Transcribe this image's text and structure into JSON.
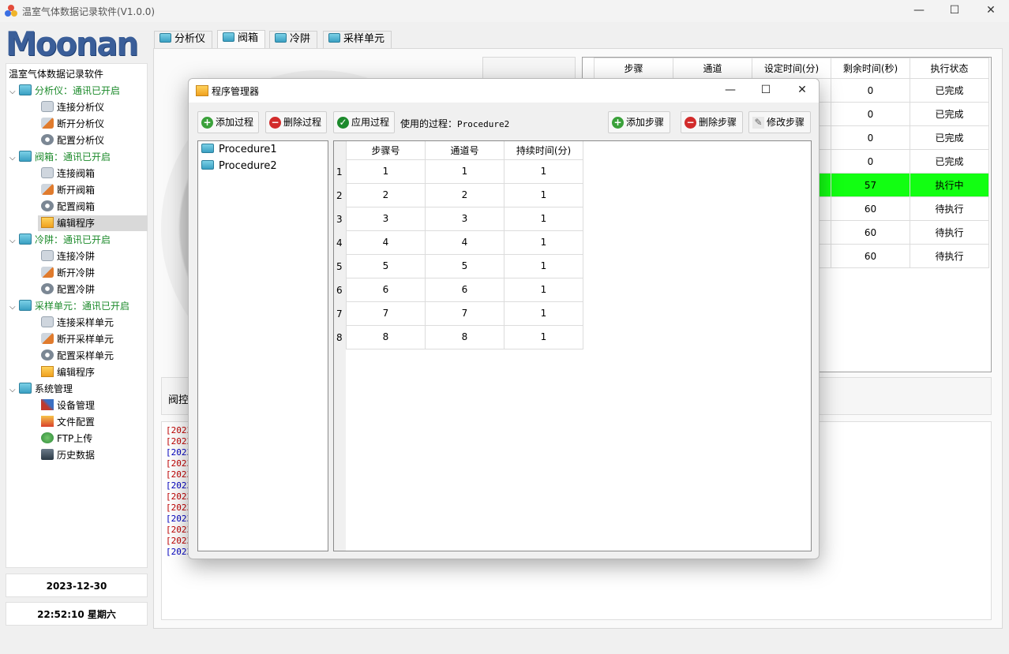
{
  "window": {
    "title": "温室气体数据记录软件(V1.0.0)",
    "minimize": "—",
    "maximize": "☐",
    "close": "✕"
  },
  "logo": "Moonan",
  "tree": {
    "header": "温室气体数据记录软件",
    "groups": [
      {
        "label": "分析仪：通讯已开启",
        "items": [
          "连接分析仪",
          "断开分析仪",
          "配置分析仪"
        ]
      },
      {
        "label": "阀箱：通讯已开启",
        "items": [
          "连接阀箱",
          "断开阀箱",
          "配置阀箱",
          "编辑程序"
        ]
      },
      {
        "label": "冷阱：通讯已开启",
        "items": [
          "连接冷阱",
          "断开冷阱",
          "配置冷阱"
        ]
      },
      {
        "label": "采样单元：通讯已开启",
        "items": [
          "连接采样单元",
          "断开采样单元",
          "配置采样单元",
          "编辑程序"
        ]
      },
      {
        "label": "系统管理",
        "items": [
          "设备管理",
          "文件配置",
          "FTP上传",
          "历史数据"
        ]
      }
    ]
  },
  "date": "2023-12-30",
  "time": "22:52:10 星期六",
  "tabs": [
    "分析仪",
    "阀箱",
    "冷阱",
    "采样单元"
  ],
  "active_tab": "阀箱",
  "step_table": {
    "columns": [
      "步骤",
      "通道",
      "设定时间(分)",
      "剩余时间(秒)",
      "执行状态"
    ],
    "rows": [
      {
        "remain": "0",
        "status": "已完成"
      },
      {
        "remain": "0",
        "status": "已完成"
      },
      {
        "remain": "0",
        "status": "已完成"
      },
      {
        "remain": "0",
        "status": "已完成"
      },
      {
        "remain": "57",
        "status": "执行中"
      },
      {
        "remain": "60",
        "status": "待执行"
      },
      {
        "remain": "60",
        "status": "待执行"
      },
      {
        "remain": "60",
        "status": "待执行"
      }
    ],
    "running_color": "#12ff12"
  },
  "valve_control_label": "阀控",
  "log_lines": [
    {
      "text": "[2023",
      "color": "#c00000"
    },
    {
      "text": "[2023",
      "color": "#c00000"
    },
    {
      "text": "[2023",
      "color": "#0000c0"
    },
    {
      "text": "[2023",
      "color": "#c00000"
    },
    {
      "text": "[2023",
      "color": "#c00000"
    },
    {
      "text": "[2023",
      "color": "#0000c0"
    },
    {
      "text": "[2023",
      "color": "#c00000"
    },
    {
      "text": "[2023",
      "color": "#c00000"
    },
    {
      "text": "[2023",
      "color": "#0000c0"
    },
    {
      "text": "[2023",
      "color": "#c00000"
    },
    {
      "text": "[2023",
      "color": "#c00000"
    },
    {
      "text": "[2023",
      "color": "#0000c0"
    }
  ],
  "dialog": {
    "title": "程序管理器",
    "buttons": {
      "add_process": "添加过程",
      "delete_process": "删除过程",
      "apply_process": "应用过程",
      "add_step": "添加步骤",
      "delete_step": "删除步骤",
      "modify_step": "修改步骤"
    },
    "used_process_label": "使用的过程：",
    "used_process_value": "Procedure2",
    "procedures": [
      "Procedure1",
      "Procedure2"
    ],
    "grid": {
      "columns": [
        "步骤号",
        "通道号",
        "持续时间(分)"
      ],
      "rows": [
        [
          "1",
          "1",
          "1"
        ],
        [
          "2",
          "2",
          "1"
        ],
        [
          "3",
          "3",
          "1"
        ],
        [
          "4",
          "4",
          "1"
        ],
        [
          "5",
          "5",
          "1"
        ],
        [
          "6",
          "6",
          "1"
        ],
        [
          "7",
          "7",
          "1"
        ],
        [
          "8",
          "8",
          "1"
        ]
      ]
    }
  }
}
